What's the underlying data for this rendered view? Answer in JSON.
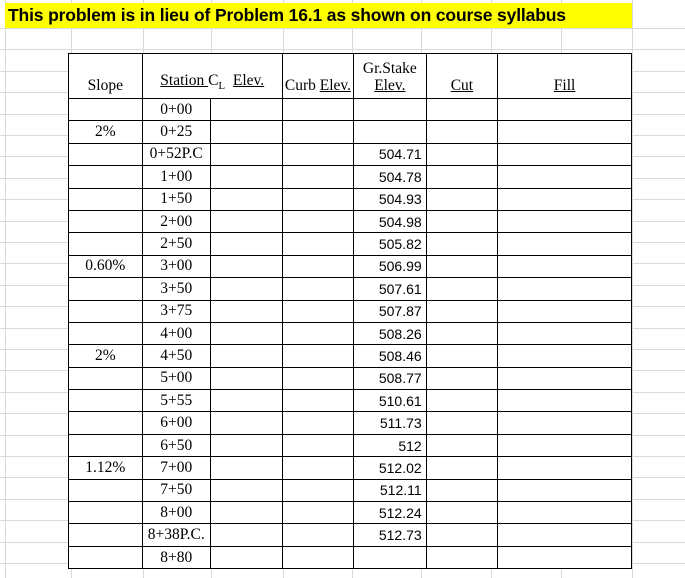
{
  "title": {
    "text": "This problem is in lieu of Problem 16.1 as shown on course syllabus",
    "highlight_color": "#ffff00",
    "text_color": "#000000"
  },
  "table": {
    "headers": {
      "slope": "Slope",
      "station": "Station",
      "centerline": "C",
      "centerline_sub": "L",
      "station_elev": "Elev.",
      "curb": "Curb",
      "curb_elev": "Elev.",
      "grade_stake_top": "Gr.Stake",
      "grade_stake_bottom": "Elev.",
      "cut": "Cut",
      "fill": "Fill"
    },
    "columns": [
      "Slope",
      "Station C_L Elev.",
      "",
      "Curb Elev.",
      "Gr.Stake Elev.",
      "Cut",
      "Fill"
    ],
    "rows": [
      {
        "slope": "",
        "station": "0+00",
        "cl_elev": "",
        "curb_elev": "",
        "gr_stake_elev": "",
        "cut": "",
        "fill": ""
      },
      {
        "slope": "2%",
        "station": "0+25",
        "cl_elev": "",
        "curb_elev": "",
        "gr_stake_elev": "",
        "cut": "",
        "fill": ""
      },
      {
        "slope": "",
        "station": "0+52P.C",
        "cl_elev": "",
        "curb_elev": "",
        "gr_stake_elev": "504.71",
        "cut": "",
        "fill": ""
      },
      {
        "slope": "",
        "station": "1+00",
        "cl_elev": "",
        "curb_elev": "",
        "gr_stake_elev": "504.78",
        "cut": "",
        "fill": ""
      },
      {
        "slope": "",
        "station": "1+50",
        "cl_elev": "",
        "curb_elev": "",
        "gr_stake_elev": "504.93",
        "cut": "",
        "fill": ""
      },
      {
        "slope": "",
        "station": "2+00",
        "cl_elev": "",
        "curb_elev": "",
        "gr_stake_elev": "504.98",
        "cut": "",
        "fill": ""
      },
      {
        "slope": "",
        "station": "2+50",
        "cl_elev": "",
        "curb_elev": "",
        "gr_stake_elev": "505.82",
        "cut": "",
        "fill": ""
      },
      {
        "slope": "0.60%",
        "station": "3+00",
        "cl_elev": "",
        "curb_elev": "",
        "gr_stake_elev": "506.99",
        "cut": "",
        "fill": ""
      },
      {
        "slope": "",
        "station": "3+50",
        "cl_elev": "",
        "curb_elev": "",
        "gr_stake_elev": "507.61",
        "cut": "",
        "fill": ""
      },
      {
        "slope": "",
        "station": "3+75",
        "cl_elev": "",
        "curb_elev": "",
        "gr_stake_elev": "507.87",
        "cut": "",
        "fill": ""
      },
      {
        "slope": "",
        "station": "4+00",
        "cl_elev": "",
        "curb_elev": "",
        "gr_stake_elev": "508.26",
        "cut": "",
        "fill": ""
      },
      {
        "slope": "2%",
        "station": "4+50",
        "cl_elev": "",
        "curb_elev": "",
        "gr_stake_elev": "508.46",
        "cut": "",
        "fill": ""
      },
      {
        "slope": "",
        "station": "5+00",
        "cl_elev": "",
        "curb_elev": "",
        "gr_stake_elev": "508.77",
        "cut": "",
        "fill": ""
      },
      {
        "slope": "",
        "station": "5+55",
        "cl_elev": "",
        "curb_elev": "",
        "gr_stake_elev": "510.61",
        "cut": "",
        "fill": ""
      },
      {
        "slope": "",
        "station": "6+00",
        "cl_elev": "",
        "curb_elev": "",
        "gr_stake_elev": "511.73",
        "cut": "",
        "fill": ""
      },
      {
        "slope": "",
        "station": "6+50",
        "cl_elev": "",
        "curb_elev": "",
        "gr_stake_elev": "512",
        "cut": "",
        "fill": ""
      },
      {
        "slope": "1.12%",
        "station": "7+00",
        "cl_elev": "",
        "curb_elev": "",
        "gr_stake_elev": "512.02",
        "cut": "",
        "fill": ""
      },
      {
        "slope": "",
        "station": "7+50",
        "cl_elev": "",
        "curb_elev": "",
        "gr_stake_elev": "512.11",
        "cut": "",
        "fill": ""
      },
      {
        "slope": "",
        "station": "8+00",
        "cl_elev": "",
        "curb_elev": "",
        "gr_stake_elev": "512.24",
        "cut": "",
        "fill": ""
      },
      {
        "slope": "",
        "station": "8+38P.C.",
        "cl_elev": "",
        "curb_elev": "",
        "gr_stake_elev": "512.73",
        "cut": "",
        "fill": ""
      },
      {
        "slope": "",
        "station": "8+80",
        "cl_elev": "",
        "curb_elev": "",
        "gr_stake_elev": "",
        "cut": "",
        "fill": ""
      }
    ]
  }
}
